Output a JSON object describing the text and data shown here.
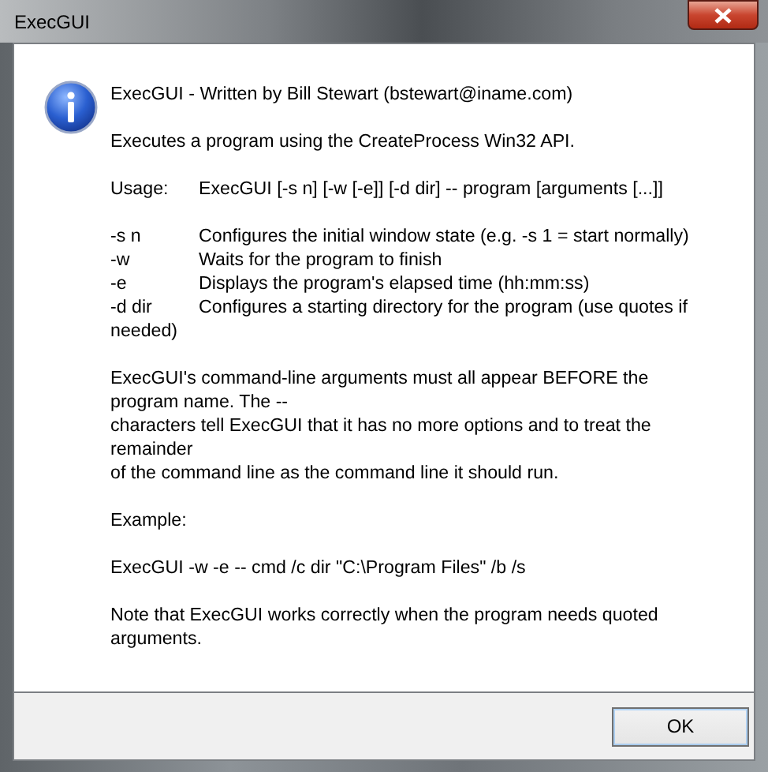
{
  "window": {
    "title": "ExecGUI"
  },
  "message": {
    "heading": "ExecGUI - Written by Bill Stewart (bstewart@iname.com)",
    "summary": "Executes a program using the CreateProcess Win32 API.",
    "usage": {
      "label": "Usage:",
      "syntax": "ExecGUI [-s n] [-w [-e]] [-d dir] -- program [arguments [...]]"
    },
    "options": [
      {
        "flag": "-s n",
        "description": [
          "Configures the initial window state (e.g. -s 1 = start normally)"
        ]
      },
      {
        "flag": "-w",
        "description": [
          "Waits for the program to finish"
        ]
      },
      {
        "flag": "-e",
        "description": [
          "Displays the program's elapsed time (hh:mm:ss)"
        ]
      },
      {
        "flag": "-d dir",
        "description": [
          "Configures a starting directory for the program (use quotes if",
          "needed)"
        ]
      }
    ],
    "note": [
      "ExecGUI's command-line arguments must all appear BEFORE the",
      "program name. The --",
      "characters tell ExecGUI that it has no more options and to treat the",
      "remainder",
      "of the command line as the command line it should run."
    ],
    "example_label": "Example:",
    "example": "ExecGUI -w -e -- cmd /c dir \"C:\\Program Files\" /b /s",
    "footer": [
      "Note that ExecGUI works correctly when the program needs quoted",
      "arguments."
    ]
  },
  "buttons": [
    {
      "label": "OK"
    }
  ]
}
